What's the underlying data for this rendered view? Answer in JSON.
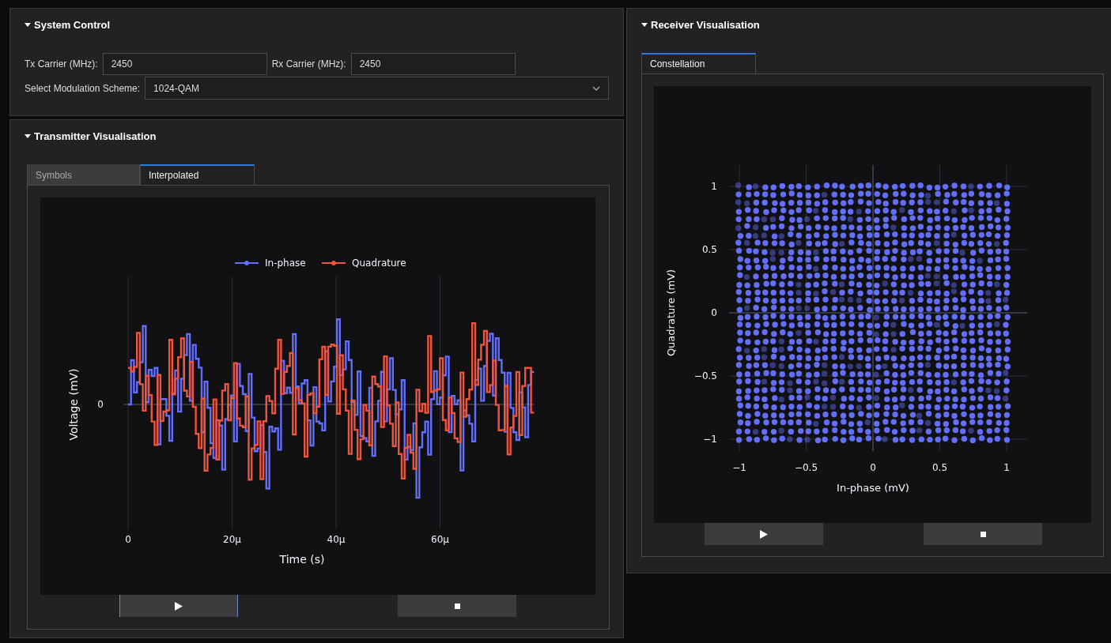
{
  "system_control": {
    "title": "System Control",
    "expanded": true,
    "tx_label": "Tx Carrier (MHz):",
    "tx_value": "2450",
    "rx_label": "Rx Carrier (MHz):",
    "rx_value": "2450",
    "modulation_label": "Select Modulation Scheme:",
    "modulation_value": "1024-QAM"
  },
  "transmitter": {
    "title": "Transmitter Visualisation",
    "expanded": true,
    "tabs": [
      {
        "label": "Symbols",
        "selected": false
      },
      {
        "label": "Interpolated",
        "selected": true
      }
    ],
    "plot": {
      "legend": [
        {
          "name": "In-phase",
          "color": "#636efa"
        },
        {
          "name": "Quadrature",
          "color": "#ef553b"
        }
      ],
      "ylabel": "Voltage (mV)",
      "yticks": [
        "0"
      ],
      "xticks": [
        "0",
        "20µ",
        "40µ",
        "60µ"
      ],
      "xlabel": "Time (s)"
    },
    "buttons": [
      {
        "kind": "play",
        "focused": true
      },
      {
        "kind": "stop",
        "focused": false
      }
    ]
  },
  "receiver": {
    "title": "Receiver Visualisation",
    "expanded": true,
    "tabs": [
      {
        "label": "Constellation",
        "selected": true
      }
    ],
    "plot": {
      "color": "#636efa",
      "xticks": [
        "−1",
        "−0.5",
        "0",
        "0.5",
        "1"
      ],
      "yticks": [
        "1",
        "0.5",
        "0",
        "−0.5",
        "−1"
      ],
      "xlabel": "In-phase (mV)",
      "ylabel": "Quadrature (mV)"
    },
    "buttons": [
      {
        "kind": "play",
        "focused": false
      },
      {
        "kind": "stop",
        "focused": false
      }
    ]
  }
}
